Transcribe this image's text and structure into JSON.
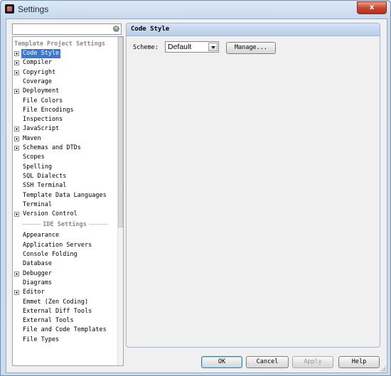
{
  "window": {
    "title": "Settings",
    "close_glyph": "x"
  },
  "search": {
    "value": "",
    "placeholder": "",
    "clear_icon": "✕"
  },
  "tree": {
    "project_header": "Template Project Settings",
    "project_items": [
      {
        "label": "Code Style",
        "expandable": true,
        "selected": true
      },
      {
        "label": "Compiler",
        "expandable": true
      },
      {
        "label": "Copyright",
        "expandable": true
      },
      {
        "label": "Coverage",
        "expandable": false
      },
      {
        "label": "Deployment",
        "expandable": true
      },
      {
        "label": "File Colors",
        "expandable": false
      },
      {
        "label": "File Encodings",
        "expandable": false
      },
      {
        "label": "Inspections",
        "expandable": false
      },
      {
        "label": "JavaScript",
        "expandable": true
      },
      {
        "label": "Maven",
        "expandable": true
      },
      {
        "label": "Schemas and DTDs",
        "expandable": true
      },
      {
        "label": "Scopes",
        "expandable": false
      },
      {
        "label": "Spelling",
        "expandable": false
      },
      {
        "label": "SQL Dialects",
        "expandable": false
      },
      {
        "label": "SSH Terminal",
        "expandable": false
      },
      {
        "label": "Template Data Languages",
        "expandable": false
      },
      {
        "label": "Terminal",
        "expandable": false
      },
      {
        "label": "Version Control",
        "expandable": true
      }
    ],
    "ide_header": "IDE Settings",
    "ide_items": [
      {
        "label": "Appearance",
        "expandable": false
      },
      {
        "label": "Application Servers",
        "expandable": false
      },
      {
        "label": "Console Folding",
        "expandable": false
      },
      {
        "label": "Database",
        "expandable": false
      },
      {
        "label": "Debugger",
        "expandable": true
      },
      {
        "label": "Diagrams",
        "expandable": false
      },
      {
        "label": "Editor",
        "expandable": true
      },
      {
        "label": "Emmet (Zen Coding)",
        "expandable": false
      },
      {
        "label": "External Diff Tools",
        "expandable": false
      },
      {
        "label": "External Tools",
        "expandable": false
      },
      {
        "label": "File and Code Templates",
        "expandable": false
      },
      {
        "label": "File Types",
        "expandable": false
      }
    ]
  },
  "panel": {
    "title": "Code Style",
    "scheme_label": "Scheme:",
    "scheme_value": "Default",
    "manage_label": "Manage..."
  },
  "buttons": {
    "ok": "OK",
    "cancel": "Cancel",
    "apply": "Apply",
    "help": "Help"
  }
}
